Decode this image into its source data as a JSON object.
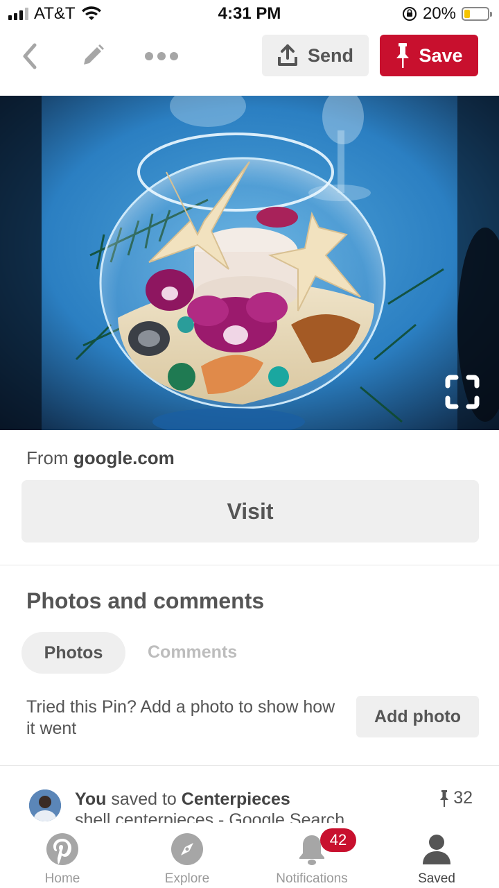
{
  "status_bar": {
    "carrier": "AT&T",
    "time": "4:31 PM",
    "battery": "20%"
  },
  "toolbar": {
    "back_icon": "chevron-left-icon",
    "edit_icon": "pencil-icon",
    "more_icon": "more-dots-icon",
    "send_label": "Send",
    "save_label": "Save"
  },
  "pin": {
    "image_description_icon": "expand-icon",
    "source_prefix": "From",
    "source_domain": "google.com",
    "visit_label": "Visit"
  },
  "photos_comments": {
    "title": "Photos and comments",
    "tabs": [
      {
        "label": "Photos",
        "active": true
      },
      {
        "label": "Comments",
        "active": false
      }
    ],
    "tried_text": "Tried this Pin? Add a photo to show how it went",
    "add_photo_label": "Add photo"
  },
  "activity": {
    "actor": "You",
    "action": "saved to",
    "board": "Centerpieces",
    "description": "shell centerpieces - Google Search",
    "pin_count": "32"
  },
  "bottom_nav": {
    "items": [
      {
        "label": "Home",
        "icon": "pinterest-logo-icon"
      },
      {
        "label": "Explore",
        "icon": "compass-icon"
      },
      {
        "label": "Notifications",
        "icon": "bell-icon"
      },
      {
        "label": "Saved",
        "icon": "person-icon"
      }
    ],
    "notifications_badge": "42",
    "active": "Saved"
  },
  "colors": {
    "brand_red": "#c8102e",
    "button_gray": "#efefef",
    "text_gray": "#555555"
  }
}
